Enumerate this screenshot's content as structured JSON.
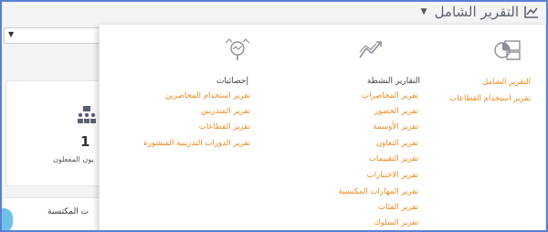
{
  "header": {
    "title": "التقرير الشامل",
    "title_icon": "line-chart-icon",
    "caret_icon": "caret-down-icon"
  },
  "background": {
    "select_arrow": "▼",
    "stat_value": "1",
    "stat_label": "بون المفعلون",
    "stat_icon": "people-group-icon",
    "bottom_label": "ت المكتسبة"
  },
  "dropdown": {
    "columns": [
      {
        "icon": "dashboard-report-icon",
        "title": "",
        "links": [
          "التقرير الشامل",
          "تقرير استخدام القطاعات"
        ]
      },
      {
        "icon": "activity-chart-icon",
        "title": "التقارير النشطة",
        "links": [
          "تقرير المحاضرات",
          "تقرير الحضور",
          "تقرير الأوسمة",
          "تقرير التعاون",
          "تقرير التقييمات",
          "تقرير الاختبارات",
          "تقرير المهارات المكتسبة",
          "تقرير الفئات",
          "تقرير السلوك"
        ]
      },
      {
        "icon": "statistics-search-icon",
        "title": "إحصائيات",
        "links": [
          "تقرير استخدام المحاضرين",
          "تقرير المتدربين",
          "تقرير القطاعات",
          "تقرير الدورات التدريبية المنشورة"
        ]
      }
    ]
  },
  "colors": {
    "link": "#e8891e",
    "frame_border": "#5b7fd6",
    "fab": "#6ec1e6"
  }
}
